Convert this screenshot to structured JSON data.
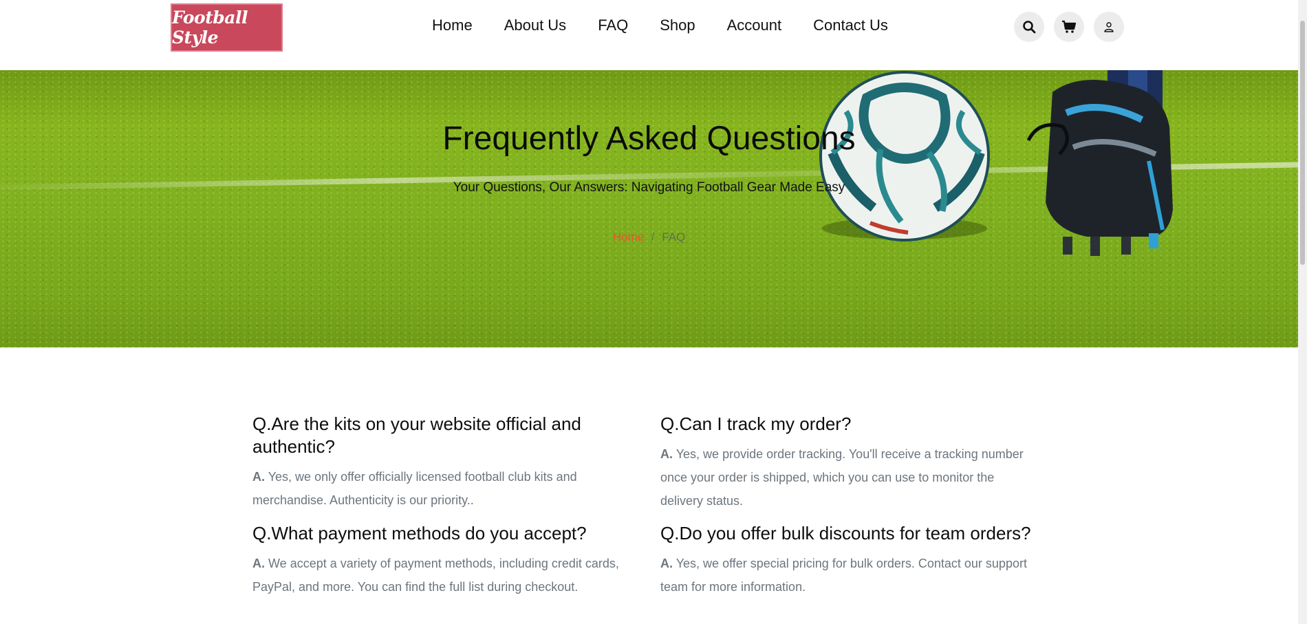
{
  "brand": {
    "logo_text": "Football Style",
    "accent": "#c9485b"
  },
  "nav": {
    "items": [
      {
        "label": "Home"
      },
      {
        "label": "About Us"
      },
      {
        "label": "FAQ"
      },
      {
        "label": "Shop"
      },
      {
        "label": "Account"
      },
      {
        "label": "Contact Us"
      }
    ]
  },
  "header_icons": [
    "search-icon",
    "cart-icon",
    "user-icon"
  ],
  "hero": {
    "title": "Frequently Asked Questions",
    "subtitle": "Your Questions, Our Answers: Navigating Football Gear Made Easy",
    "breadcrumb": {
      "home": "Home",
      "separator": "/",
      "current": "FAQ"
    },
    "breadcrumb_home_color": "#e8552b"
  },
  "faq": {
    "answer_prefix": "A.",
    "items": [
      {
        "question": "Q.Are the kits on your website official and authentic?",
        "answer": "Yes, we only offer officially licensed football club kits and merchandise. Authenticity is our priority.."
      },
      {
        "question": "Q.Can I track my order?",
        "answer": "Yes, we provide order tracking. You'll receive a tracking number once your order is shipped, which you can use to monitor the delivery status."
      },
      {
        "question": "Q.What payment methods do you accept?",
        "answer": "We accept a variety of payment methods, including credit cards, PayPal, and more. You can find the full list during checkout."
      },
      {
        "question": "Q.Do you offer bulk discounts for team orders?",
        "answer": "Yes, we offer special pricing for bulk orders. Contact our support team for more information."
      }
    ]
  }
}
